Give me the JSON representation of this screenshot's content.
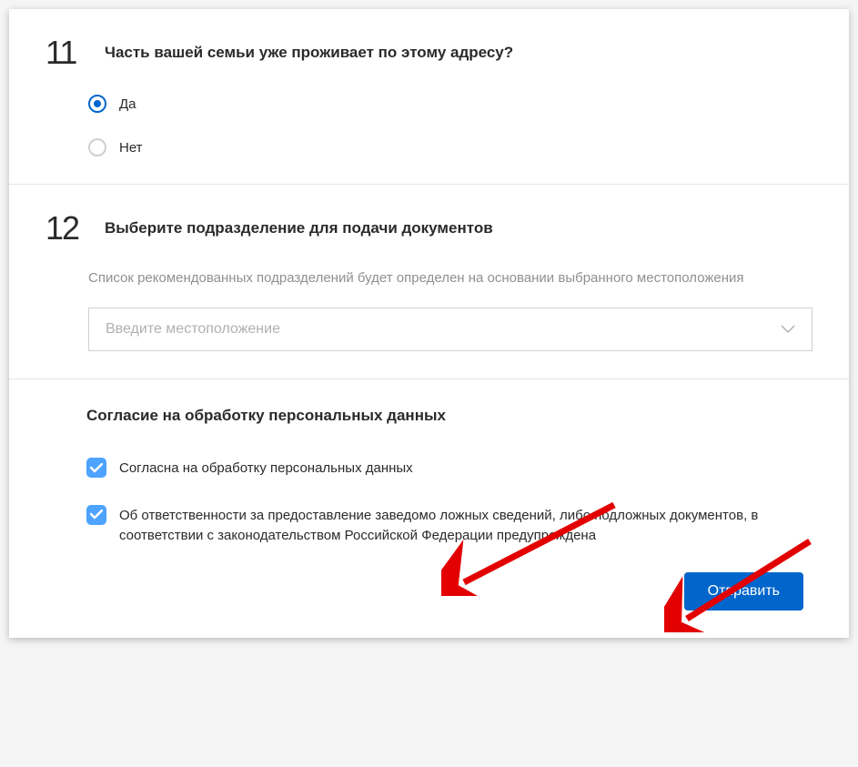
{
  "section11": {
    "number": "11",
    "title": "Часть вашей семьи уже проживает по этому адресу?",
    "options": {
      "yes": "Да",
      "no": "Нет"
    }
  },
  "section12": {
    "number": "12",
    "title": "Выберите подразделение для подачи документов",
    "description": "Список рекомендованных подразделений будет определен на основании выбранного местоположения",
    "placeholder": "Введите местоположение"
  },
  "consent": {
    "title": "Согласие на обработку персональных данных",
    "checkbox1": "Согласна на обработку персональных данных",
    "checkbox2": "Об ответственности за предоставление заведомо ложных сведений, либо подложных документов, в соответствии с законодательством Российской Федерации предупреждена"
  },
  "submit_label": "Отправить"
}
